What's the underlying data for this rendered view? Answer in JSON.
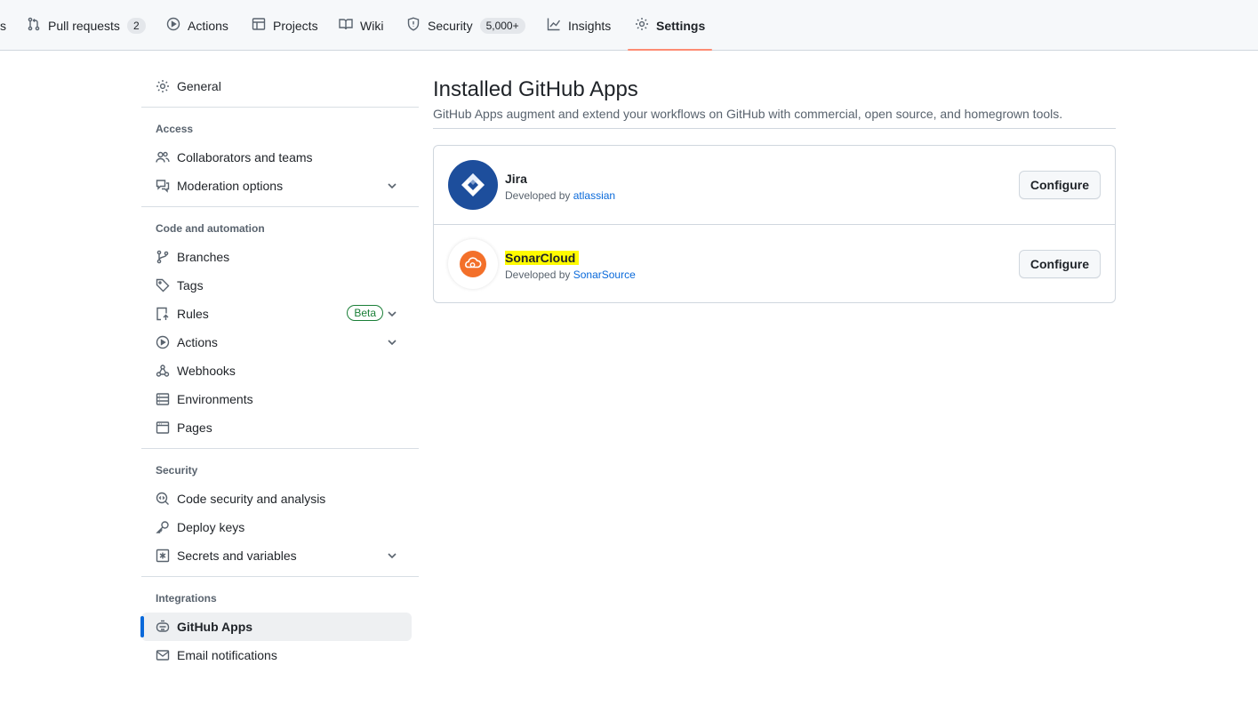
{
  "repo_nav": {
    "partial_left": "s",
    "tabs": [
      {
        "label": "Pull requests",
        "counter": "2",
        "icon": "git-pull-request-icon"
      },
      {
        "label": "Actions",
        "icon": "play-icon"
      },
      {
        "label": "Projects",
        "icon": "table-icon"
      },
      {
        "label": "Wiki",
        "icon": "book-icon"
      },
      {
        "label": "Security",
        "counter": "5,000+",
        "icon": "shield-icon"
      },
      {
        "label": "Insights",
        "icon": "graph-icon"
      },
      {
        "label": "Settings",
        "icon": "gear-icon",
        "selected": true
      }
    ]
  },
  "sidebar": {
    "general": "General",
    "sections": {
      "access": "Access",
      "code_automation": "Code and automation",
      "security": "Security",
      "integrations": "Integrations"
    },
    "items": {
      "collaborators": "Collaborators and teams",
      "moderation": "Moderation options",
      "branches": "Branches",
      "tags": "Tags",
      "rules": "Rules",
      "rules_badge": "Beta",
      "actions": "Actions",
      "webhooks": "Webhooks",
      "environments": "Environments",
      "pages": "Pages",
      "code_security": "Code security and analysis",
      "deploy_keys": "Deploy keys",
      "secrets": "Secrets and variables",
      "github_apps": "GitHub Apps",
      "email_notifications": "Email notifications"
    }
  },
  "main": {
    "title": "Installed GitHub Apps",
    "description": "GitHub Apps augment and extend your workflows on GitHub with commercial, open source, and homegrown tools.",
    "apps": [
      {
        "name": "Jira",
        "developed_by_prefix": "Developed by",
        "developer": "atlassian",
        "button": "Configure",
        "logo_color": "#1d4e9c"
      },
      {
        "name": "SonarCloud",
        "developed_by_prefix": "Developed by",
        "developer": "SonarSource",
        "button": "Configure",
        "logo_color": "#f3702a",
        "highlighted": true
      }
    ]
  },
  "colors": {
    "accent_link": "#0969da",
    "selected_tab_underline": "#fd8c73",
    "beta_green": "#1a7f37",
    "highlight_yellow": "#fffb00"
  }
}
